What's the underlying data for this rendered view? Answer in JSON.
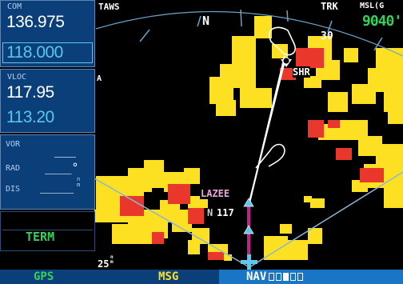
{
  "com": {
    "label": "COM",
    "active": "136.975",
    "standby": "118.000"
  },
  "vloc": {
    "label": "VLOC",
    "active": "117.95",
    "standby": "113.20"
  },
  "vor": {
    "label": "VOR",
    "value": "___",
    "rad_label": "RAD",
    "rad_value": "____°",
    "dis_label": "DIS",
    "dis_value": "_____",
    "dis_unit": "n m"
  },
  "term_label": "TERM",
  "map": {
    "taws": "TAWS",
    "heading": "N",
    "trk": "TRK",
    "msl": "MSL(G",
    "altitude": "9040'",
    "tick_30": "30",
    "left_A": "A",
    "waypoint_shr": "SHR",
    "waypoint_lazee": "LAZEE",
    "alt_label": "117",
    "alt_prefix": "N",
    "range": "25",
    "range_unit": "n m"
  },
  "tabs": {
    "gps": "GPS",
    "msg": "MSG",
    "nav": "NAV"
  },
  "colors": {
    "terrain_yellow": "#fde021",
    "terrain_red": "#e9372b",
    "panel": "#0b3f7a",
    "route_magenta": "#c21f8f",
    "accent_cyan": "#5cc7ef"
  }
}
